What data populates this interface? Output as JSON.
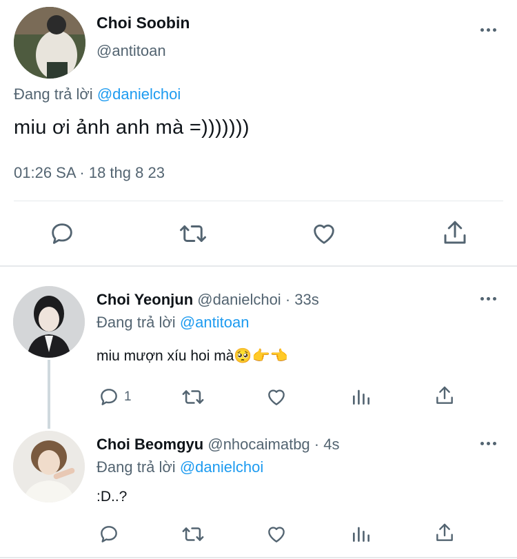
{
  "main_tweet": {
    "author_name": "Choi Soobin",
    "handle": "@antitoan",
    "reply_prefix": "Đang trả lời",
    "reply_to": "@danielchoi",
    "text": "miu ơi ảnh anh mà =)))))))",
    "timestamp": "01:26 SA · 18 thg 8 23",
    "actions": [
      "reply-icon",
      "retweet-icon",
      "like-icon",
      "share-icon"
    ]
  },
  "replies": [
    {
      "author_name": "Choi Yeonjun",
      "handle": "@danielchoi",
      "time": "· 33s",
      "reply_prefix": "Đang trả lời",
      "reply_to": "@antitoan",
      "text": "miu mượn xíu hoi mà🥺👉👈",
      "reply_count": "1"
    },
    {
      "author_name": "Choi Beomgyu",
      "handle": "@nhocaimatbg",
      "time": "· 4s",
      "reply_prefix": "Đang trả lời",
      "reply_to": "@danielchoi",
      "text": ":D..?",
      "reply_count": ""
    }
  ],
  "colors": {
    "link": "#1d9bf0",
    "muted": "#536471",
    "divider": "#eff3f4"
  }
}
